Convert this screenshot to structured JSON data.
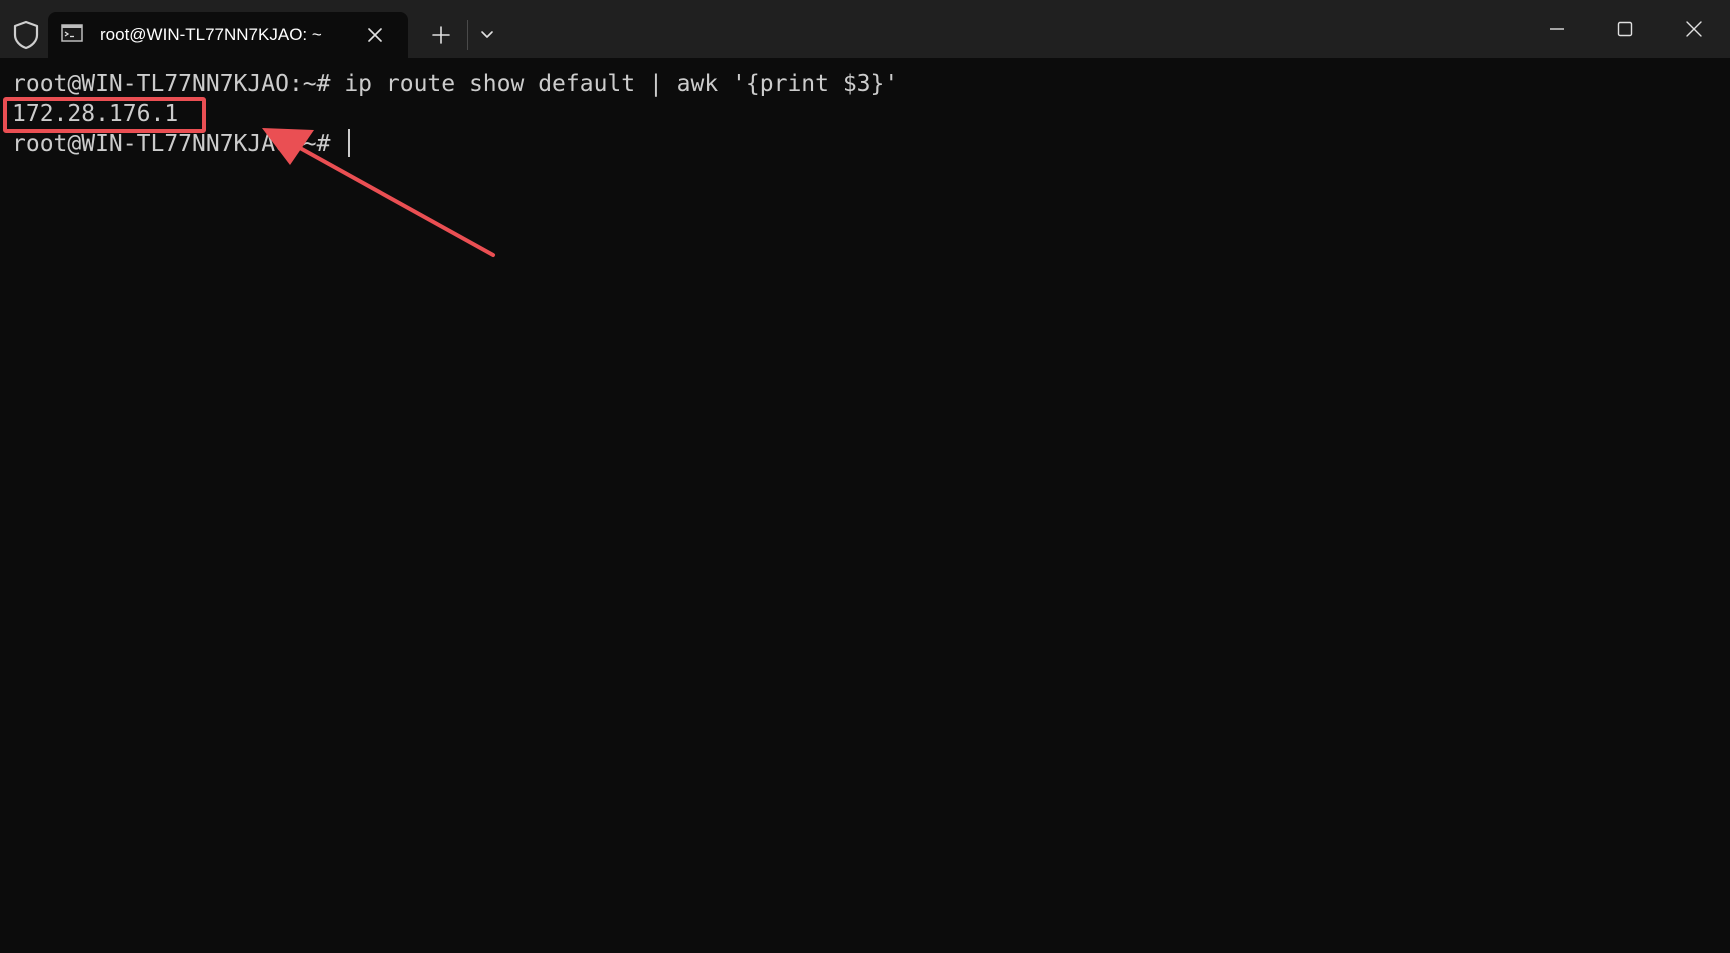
{
  "window": {
    "tab_title": "root@WIN-TL77NN7KJAO: ~",
    "icons": {
      "shield": "shield-icon",
      "terminal": "terminal-icon",
      "tab_close": "close-icon",
      "new_tab": "plus-icon",
      "dropdown": "chevron-down-icon",
      "minimize": "minimize-icon",
      "maximize": "maximize-icon",
      "close": "close-icon"
    }
  },
  "terminal": {
    "lines": [
      "root@WIN-TL77NN7KJAO:~# ip route show default | awk '{print $3}'",
      "172.28.176.1",
      "root@WIN-TL77NN7KJAO:~# "
    ]
  },
  "annotation": {
    "color": "#ea4f53"
  },
  "colors": {
    "background": "#0c0c0c",
    "titlebar": "#202020",
    "text": "#cccccc"
  }
}
